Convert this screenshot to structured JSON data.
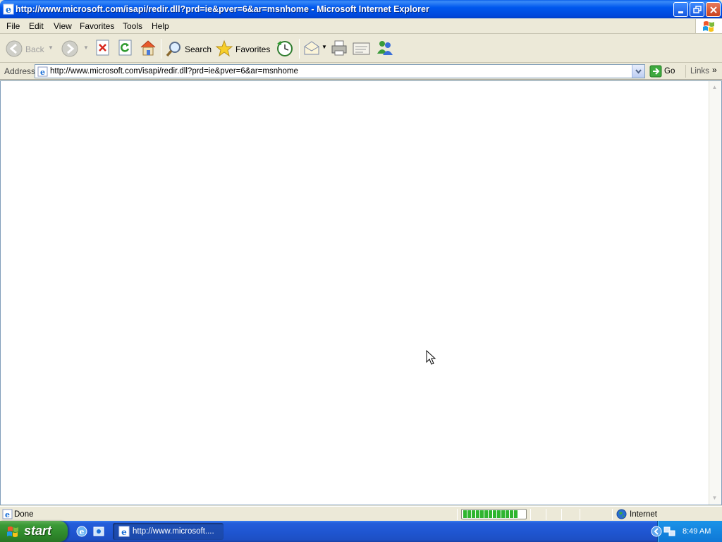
{
  "window": {
    "title": "http://www.microsoft.com/isapi/redir.dll?prd=ie&pver=6&ar=msnhome - Microsoft Internet Explorer"
  },
  "menu": {
    "items": [
      {
        "label": "File"
      },
      {
        "label": "Edit"
      },
      {
        "label": "View"
      },
      {
        "label": "Favorites"
      },
      {
        "label": "Tools"
      },
      {
        "label": "Help"
      }
    ]
  },
  "toolbar": {
    "back_label": "Back",
    "search_label": "Search",
    "favorites_label": "Favorites"
  },
  "address": {
    "label": "Address",
    "value": "http://www.microsoft.com/isapi/redir.dll?prd=ie&pver=6&ar=msnhome",
    "go_label": "Go",
    "links_label": "Links"
  },
  "status": {
    "text": "Done",
    "zone": "Internet",
    "progress": 1.0
  },
  "taskbar": {
    "start_label": "start",
    "task_label": "http://www.microsoft....",
    "clock": "8:49 AM"
  },
  "colors": {
    "titlebar": "#0054E3",
    "taskbar": "#245EDB",
    "start_button": "#3C9A37",
    "progress_fill": "#2FB52F"
  },
  "icons": [
    "ie-icon",
    "back-icon",
    "forward-icon",
    "stop-icon",
    "refresh-icon",
    "home-icon",
    "search-icon",
    "favorites-icon",
    "history-icon",
    "mail-icon",
    "print-icon",
    "edit-icon",
    "messenger-icon",
    "go-icon",
    "globe-icon",
    "windows-flag-icon"
  ]
}
